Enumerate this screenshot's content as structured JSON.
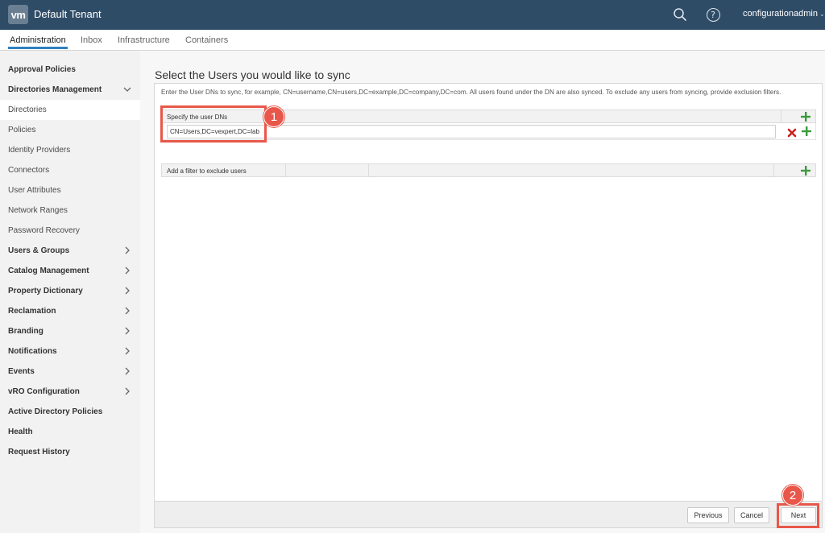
{
  "header": {
    "logo_text": "vm",
    "tenant": "Default Tenant",
    "user": "configurationadmin",
    "user_caret": "⌄"
  },
  "nav": {
    "tabs": [
      "Administration",
      "Inbox",
      "Infrastructure",
      "Containers"
    ],
    "active": "Administration"
  },
  "sidebar": {
    "items": [
      {
        "label": "Approval Policies",
        "bold": true,
        "chevron": "none"
      },
      {
        "label": "Directories Management",
        "bold": true,
        "chevron": "down"
      },
      {
        "label": "Directories",
        "bold": false,
        "chevron": "none",
        "selected": true
      },
      {
        "label": "Policies",
        "bold": false,
        "chevron": "none"
      },
      {
        "label": "Identity Providers",
        "bold": false,
        "chevron": "none"
      },
      {
        "label": "Connectors",
        "bold": false,
        "chevron": "none"
      },
      {
        "label": "User Attributes",
        "bold": false,
        "chevron": "none"
      },
      {
        "label": "Network Ranges",
        "bold": false,
        "chevron": "none"
      },
      {
        "label": "Password Recovery",
        "bold": false,
        "chevron": "none"
      },
      {
        "label": "Users & Groups",
        "bold": true,
        "chevron": "right"
      },
      {
        "label": "Catalog Management",
        "bold": true,
        "chevron": "right"
      },
      {
        "label": "Property Dictionary",
        "bold": true,
        "chevron": "right"
      },
      {
        "label": "Reclamation",
        "bold": true,
        "chevron": "right"
      },
      {
        "label": "Branding",
        "bold": true,
        "chevron": "right"
      },
      {
        "label": "Notifications",
        "bold": true,
        "chevron": "right"
      },
      {
        "label": "Events",
        "bold": true,
        "chevron": "right"
      },
      {
        "label": "vRO Configuration",
        "bold": true,
        "chevron": "right"
      },
      {
        "label": "Active Directory Policies",
        "bold": true,
        "chevron": "none"
      },
      {
        "label": "Health",
        "bold": true,
        "chevron": "none"
      },
      {
        "label": "Request History",
        "bold": true,
        "chevron": "none"
      }
    ]
  },
  "main": {
    "title": "Select the Users you would like to sync",
    "description": "Enter the User DNs to sync, for example, CN=username,CN=users,DC=example,DC=company,DC=com. All users found under the DN are also synced. To exclude any users from syncing, provide exclusion filters.",
    "dn_section": {
      "header": "Specify the user DNs",
      "value": "CN=Users,DC=vexpert,DC=lab"
    },
    "filter_section": {
      "header": "Add a filter to exclude users"
    }
  },
  "footer": {
    "previous": "Previous",
    "cancel": "Cancel",
    "next": "Next"
  },
  "annotations": {
    "step1": "1",
    "step2": "2",
    "color": "#e8574a"
  },
  "icons": {
    "search": "search-icon",
    "help": "help-icon",
    "add": "plus-icon",
    "remove": "close-icon"
  },
  "colors": {
    "header_bg": "#2f4c67",
    "accent": "#2f80c0",
    "plus_green": "#3c9a3c",
    "remove_red": "#cc1f1f"
  }
}
